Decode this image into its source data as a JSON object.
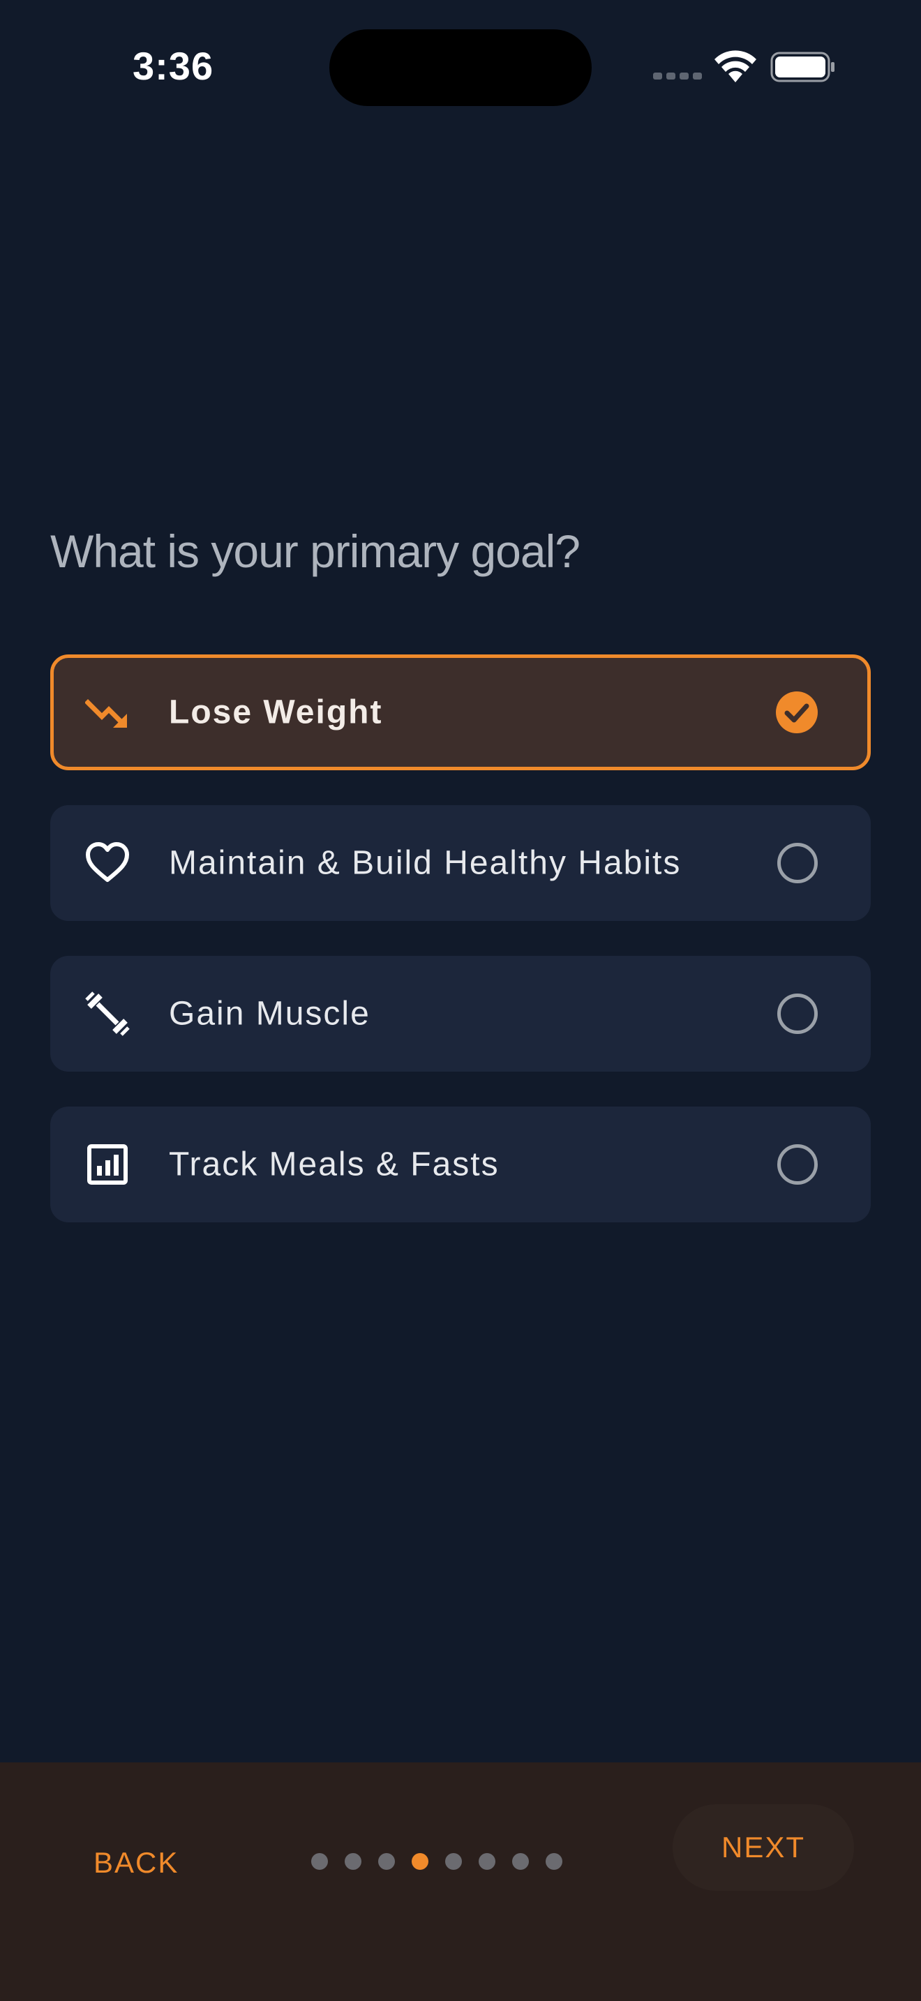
{
  "status_bar": {
    "time": "3:36"
  },
  "question": "What is your primary goal?",
  "colors": {
    "accent": "#f08a2b",
    "background": "#111a2a",
    "card": "#1c263b",
    "selected_card": "#3d2e2b"
  },
  "options": [
    {
      "label": "Lose Weight",
      "icon": "trending-down-icon",
      "selected": true
    },
    {
      "label": "Maintain & Build Healthy Habits",
      "icon": "heart-icon",
      "selected": false
    },
    {
      "label": "Gain Muscle",
      "icon": "dumbbell-icon",
      "selected": false
    },
    {
      "label": "Track Meals & Fasts",
      "icon": "bar-chart-icon",
      "selected": false
    }
  ],
  "footer": {
    "back_label": "BACK",
    "next_label": "NEXT",
    "page_count": 8,
    "current_page": 4
  }
}
